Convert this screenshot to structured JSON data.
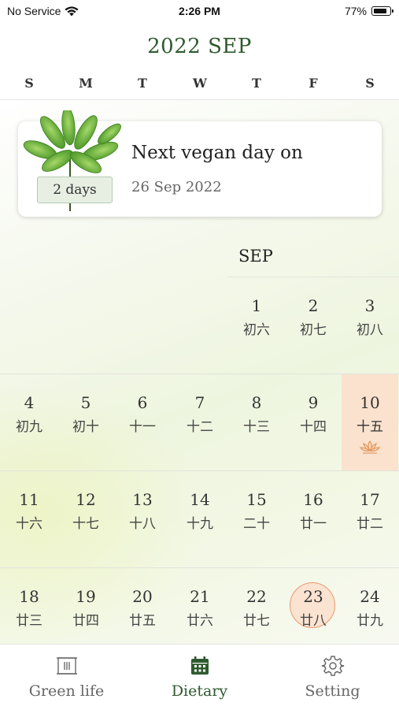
{
  "status_bar": {
    "carrier": "No Service",
    "time": "2:26 PM",
    "battery": "77%"
  },
  "calendar_title": "2022 SEP",
  "weekdays": [
    "S",
    "M",
    "T",
    "W",
    "T",
    "F",
    "S"
  ],
  "next_day_card": {
    "title": "Next vegan day on",
    "date": "26 Sep 2022",
    "badge": "2 days"
  },
  "month_label": "SEP",
  "days": [
    {
      "num": "1",
      "lunar": "初六"
    },
    {
      "num": "2",
      "lunar": "初七"
    },
    {
      "num": "3",
      "lunar": "初八"
    },
    {
      "num": "4",
      "lunar": "初九"
    },
    {
      "num": "5",
      "lunar": "初十"
    },
    {
      "num": "6",
      "lunar": "十一"
    },
    {
      "num": "7",
      "lunar": "十二"
    },
    {
      "num": "8",
      "lunar": "十三"
    },
    {
      "num": "9",
      "lunar": "十四"
    },
    {
      "num": "10",
      "lunar": "十五"
    },
    {
      "num": "11",
      "lunar": "十六"
    },
    {
      "num": "12",
      "lunar": "十七"
    },
    {
      "num": "13",
      "lunar": "十八"
    },
    {
      "num": "14",
      "lunar": "十九"
    },
    {
      "num": "15",
      "lunar": "二十"
    },
    {
      "num": "16",
      "lunar": "廿一"
    },
    {
      "num": "17",
      "lunar": "廿二"
    },
    {
      "num": "18",
      "lunar": "廿三"
    },
    {
      "num": "19",
      "lunar": "廿四"
    },
    {
      "num": "20",
      "lunar": "廿五"
    },
    {
      "num": "21",
      "lunar": "廿六"
    },
    {
      "num": "22",
      "lunar": "廿七"
    },
    {
      "num": "23",
      "lunar": "廿八"
    },
    {
      "num": "24",
      "lunar": "廿九"
    }
  ],
  "tabs": [
    {
      "label": "Green life",
      "icon": "scroll-icon"
    },
    {
      "label": "Dietary",
      "icon": "calendar-icon"
    },
    {
      "label": "Setting",
      "icon": "gear-icon"
    }
  ],
  "colors": {
    "accent": "#2f5a2f",
    "highlight": "#fae2cf",
    "lotus": "#e3995f"
  }
}
